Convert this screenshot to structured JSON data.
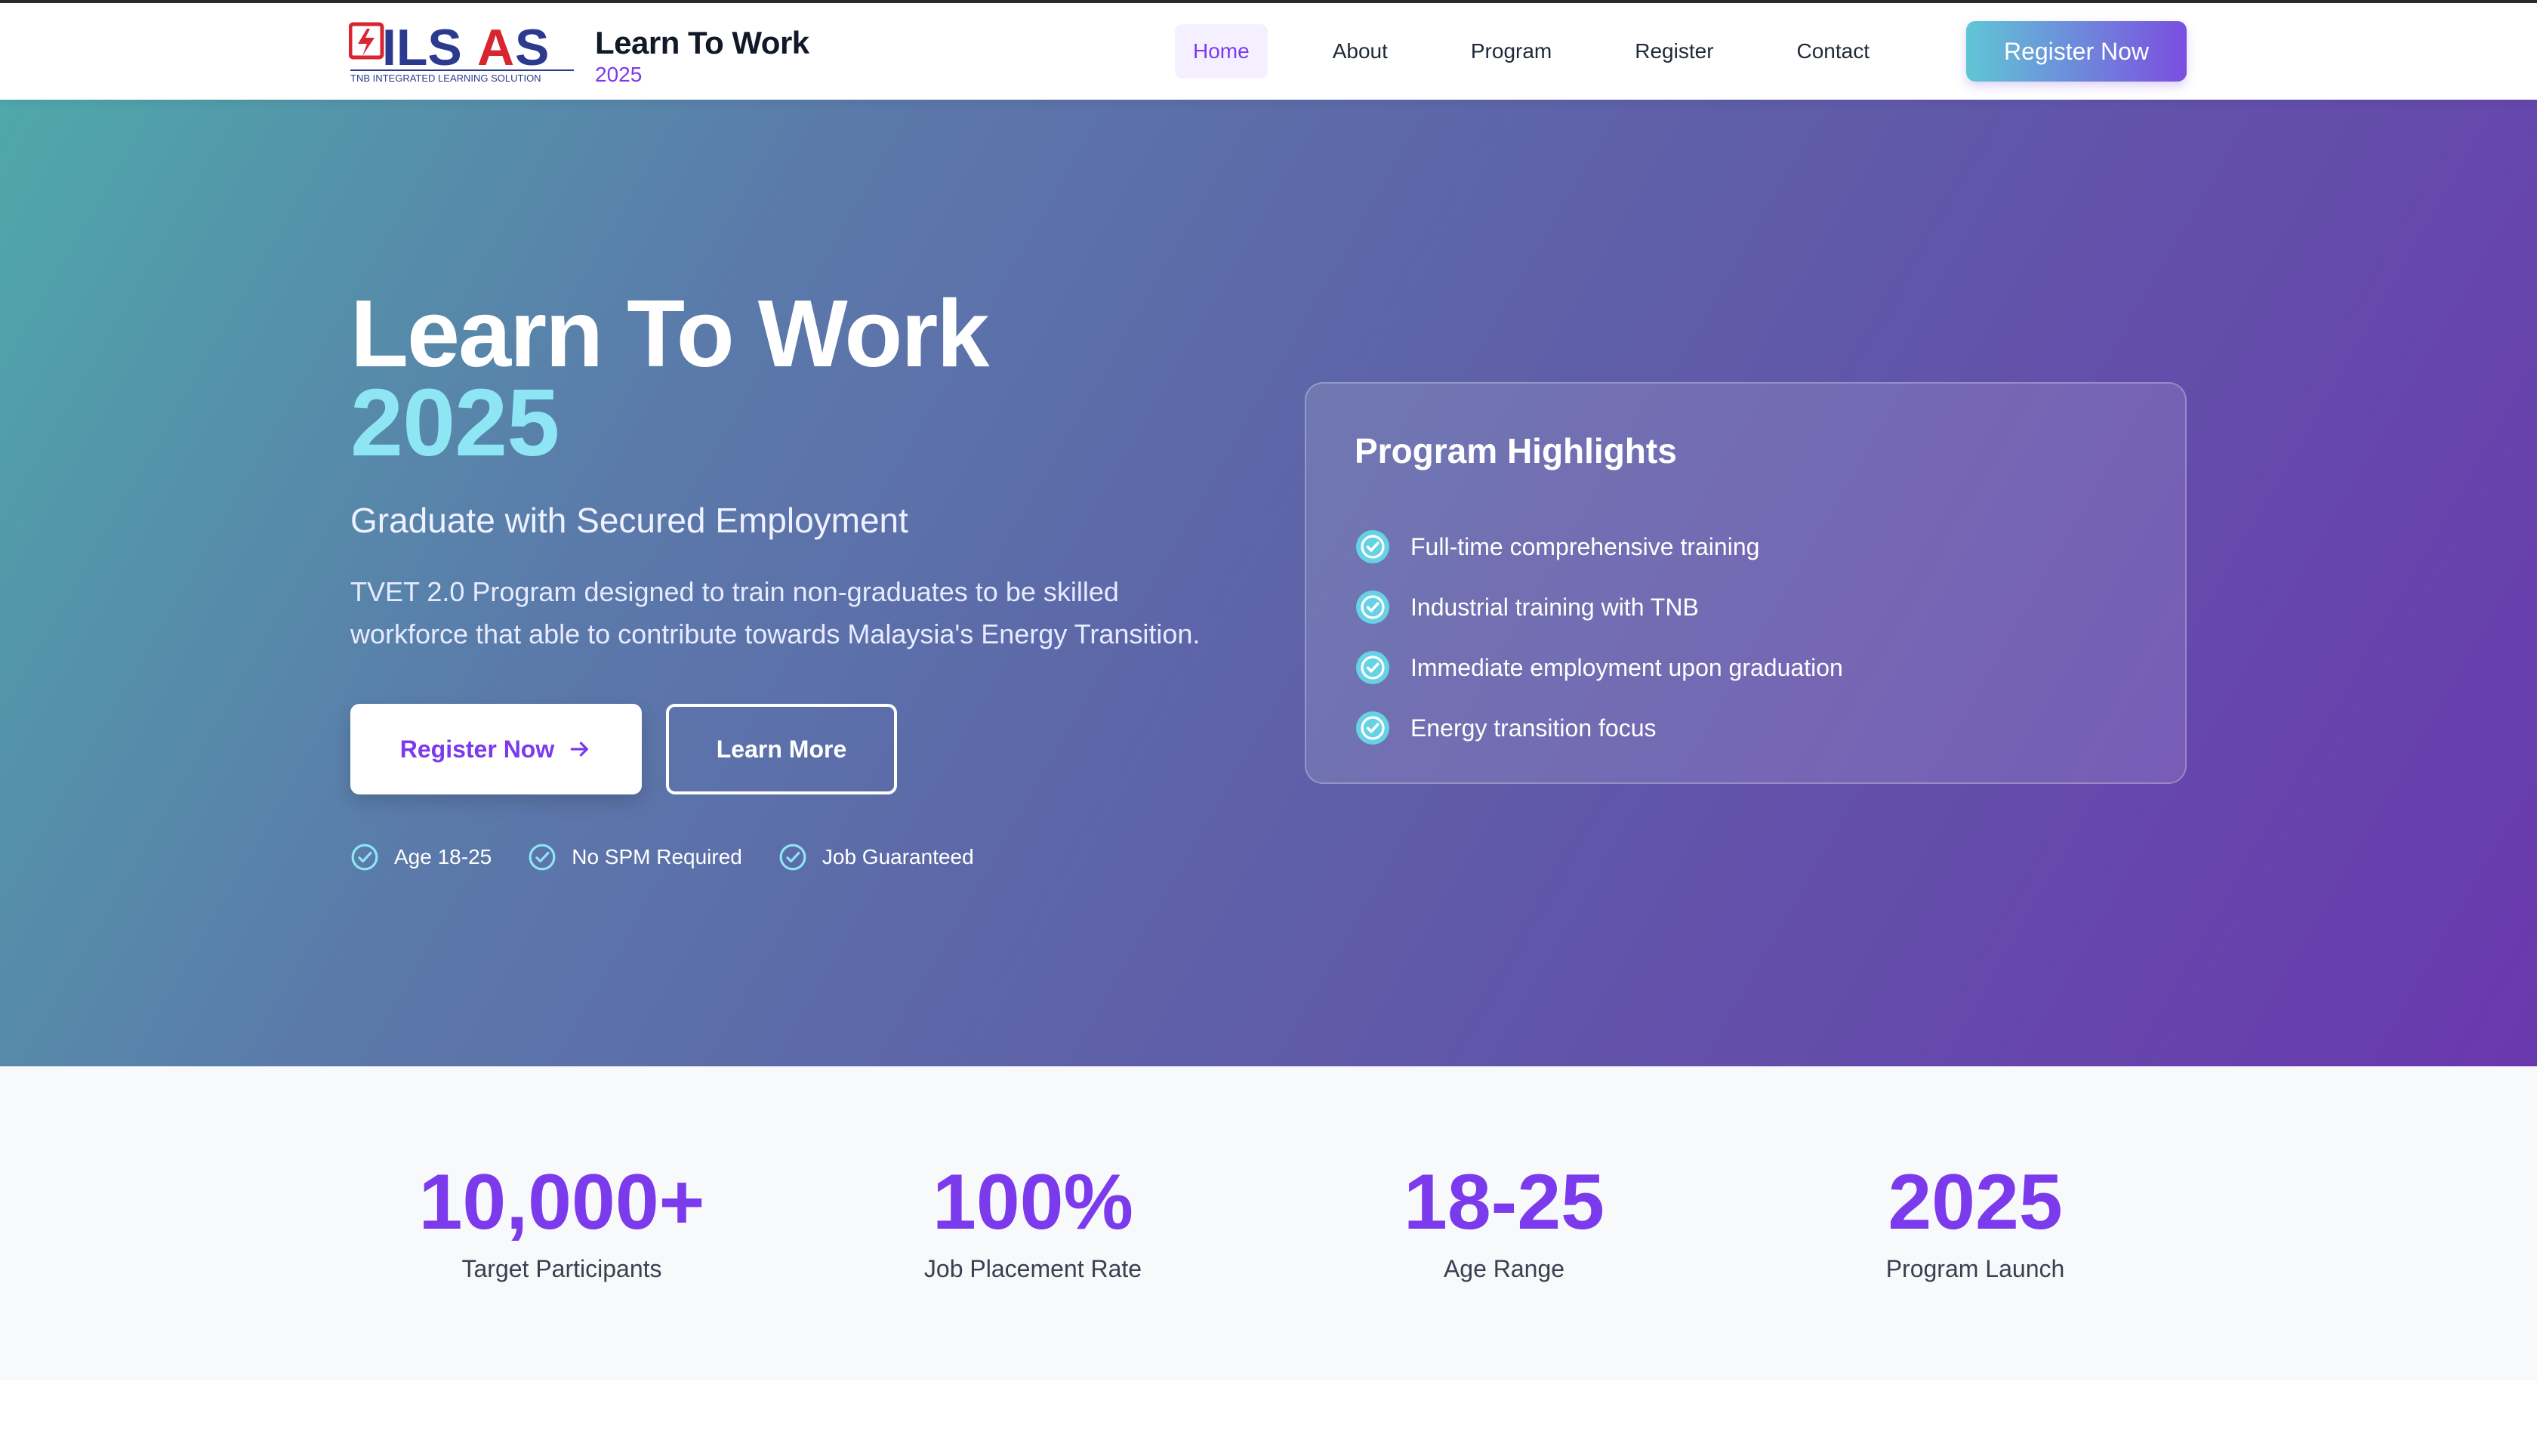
{
  "header": {
    "logo_text": "ILSAS",
    "logo_tagline": "TNB INTEGRATED LEARNING SOLUTION",
    "brand_title": "Learn To Work",
    "brand_year": "2025",
    "nav": [
      {
        "label": "Home",
        "active": true
      },
      {
        "label": "About",
        "active": false
      },
      {
        "label": "Program",
        "active": false
      },
      {
        "label": "Register",
        "active": false
      },
      {
        "label": "Contact",
        "active": false
      }
    ],
    "cta_label": "Register Now"
  },
  "hero": {
    "title": "Learn To Work",
    "year": "2025",
    "subtitle": "Graduate with Secured Employment",
    "description": "TVET 2.0 Program designed to train non-graduates to be skilled workforce that able to contribute towards Malaysia's Energy Transition.",
    "primary_button": "Register Now",
    "secondary_button": "Learn More",
    "badges": [
      "Age 18-25",
      "No SPM Required",
      "Job Guaranteed"
    ]
  },
  "highlights": {
    "title": "Program Highlights",
    "items": [
      "Full-time comprehensive training",
      "Industrial training with TNB",
      "Immediate employment upon graduation",
      "Energy transition focus"
    ]
  },
  "stats": [
    {
      "value": "10,000+",
      "label": "Target Participants"
    },
    {
      "value": "100%",
      "label": "Job Placement Rate"
    },
    {
      "value": "18-25",
      "label": "Age Range"
    },
    {
      "value": "2025",
      "label": "Program Launch"
    }
  ],
  "colors": {
    "accent": "#7c3aed",
    "highlight": "#8ee6f5",
    "logo_blue": "#2b3a8f",
    "logo_red": "#d7262f"
  }
}
